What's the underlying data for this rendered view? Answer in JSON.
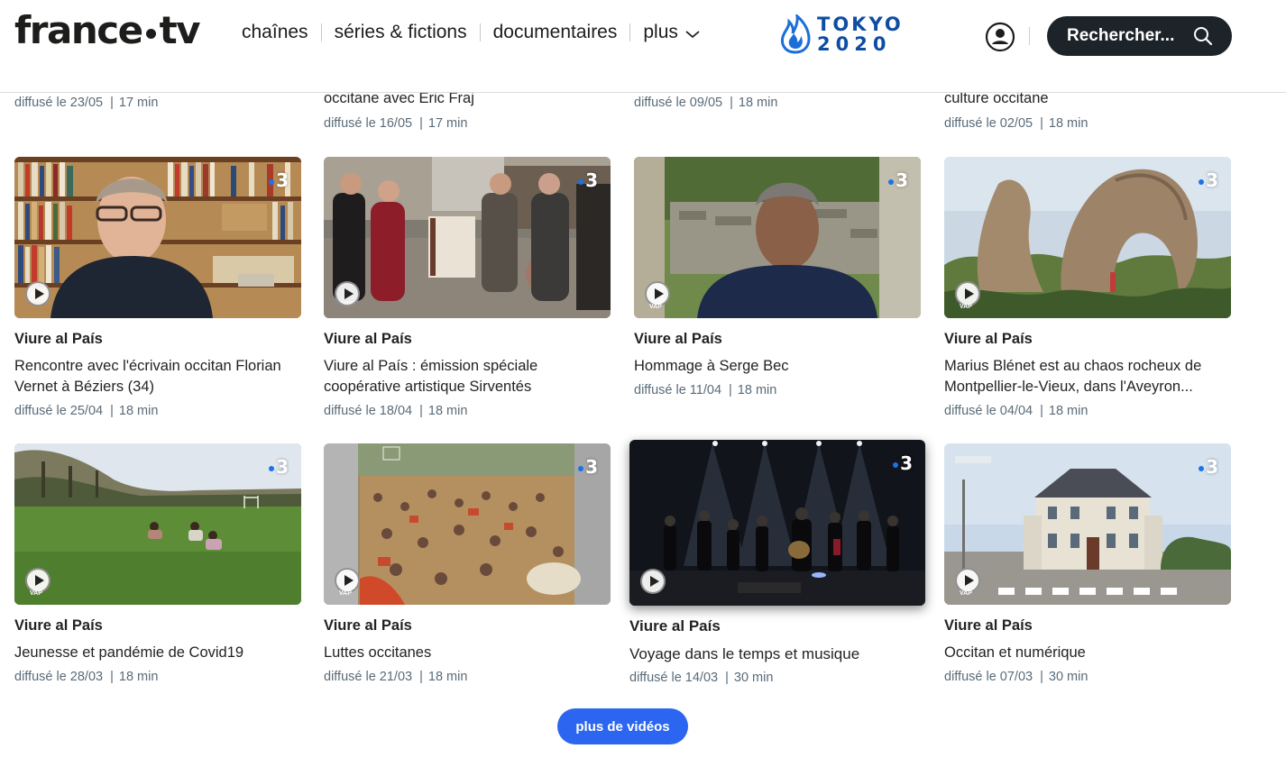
{
  "header": {
    "logo_left": "france",
    "logo_right": "tv",
    "nav": [
      {
        "label": "chaînes"
      },
      {
        "label": "séries & fictions"
      },
      {
        "label": "documentaires"
      },
      {
        "label": "plus"
      }
    ],
    "event_logo": {
      "line1": "TOKYO",
      "line2": "2020"
    },
    "search_label": "Rechercher..."
  },
  "partial_row": [
    {
      "title": "",
      "date": "diffusé le 23/05",
      "duration": "17 min"
    },
    {
      "title": "occitane avec Eric Fraj",
      "date": "diffusé le 16/05",
      "duration": "17 min"
    },
    {
      "title": "",
      "date": "diffusé le 09/05",
      "duration": "18 min"
    },
    {
      "title": "culture occitane",
      "date": "diffusé le 02/05",
      "duration": "18 min"
    }
  ],
  "cards": [
    {
      "show": "Viure al País",
      "title": "Rencontre avec l'écrivain occitan Florian Vernet à Béziers (34)",
      "date": "diffusé le 25/04",
      "duration": "18 min",
      "channel": "3"
    },
    {
      "show": "Viure al País",
      "title": "Viure al País : émission spéciale coopérative artistique Sirventés",
      "date": "diffusé le 18/04",
      "duration": "18 min",
      "channel": "3"
    },
    {
      "show": "Viure al País",
      "title": "Hommage à Serge Bec",
      "date": "diffusé le 11/04",
      "duration": "18 min",
      "channel": "3",
      "badge": "VAP"
    },
    {
      "show": "Viure al País",
      "title": "Marius Blénet est au chaos rocheux de Montpellier-le-Vieux, dans l'Aveyron...",
      "date": "diffusé le 04/04",
      "duration": "18 min",
      "channel": "3",
      "badge": "VAP"
    },
    {
      "show": "Viure al País",
      "title": "Jeunesse et pandémie de Covid19",
      "date": "diffusé le 28/03",
      "duration": "18 min",
      "channel": "3",
      "badge": "VAP"
    },
    {
      "show": "Viure al País",
      "title": "Luttes occitanes",
      "date": "diffusé le 21/03",
      "duration": "18 min",
      "channel": "3",
      "badge": "VAP"
    },
    {
      "show": "Viure al País",
      "title": "Voyage dans le temps et musique",
      "date": "diffusé le 14/03",
      "duration": "30 min",
      "channel": "3"
    },
    {
      "show": "Viure al País",
      "title": "Occitan et numérique",
      "date": "diffusé le 07/03",
      "duration": "30 min",
      "channel": "3",
      "badge": "VAP"
    }
  ],
  "more_button": "plus de vidéos",
  "colors": {
    "accent": "#2c66f0",
    "search_bg": "#1c2329",
    "channel_dot": "#1a73e8",
    "meta_text": "#5a6b79",
    "tokyo_blue": "#0f4da2"
  }
}
